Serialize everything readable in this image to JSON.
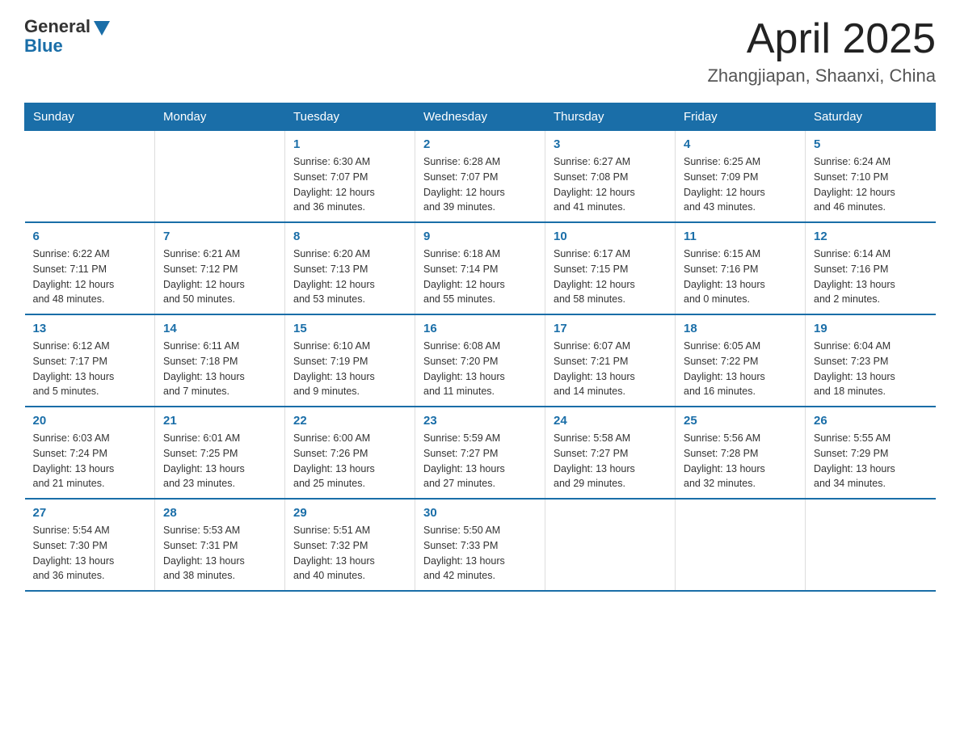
{
  "logo": {
    "general": "General",
    "blue": "Blue"
  },
  "title": {
    "month_year": "April 2025",
    "location": "Zhangjiapan, Shaanxi, China"
  },
  "weekdays": [
    "Sunday",
    "Monday",
    "Tuesday",
    "Wednesday",
    "Thursday",
    "Friday",
    "Saturday"
  ],
  "weeks": [
    [
      {
        "day": "",
        "info": ""
      },
      {
        "day": "",
        "info": ""
      },
      {
        "day": "1",
        "info": "Sunrise: 6:30 AM\nSunset: 7:07 PM\nDaylight: 12 hours\nand 36 minutes."
      },
      {
        "day": "2",
        "info": "Sunrise: 6:28 AM\nSunset: 7:07 PM\nDaylight: 12 hours\nand 39 minutes."
      },
      {
        "day": "3",
        "info": "Sunrise: 6:27 AM\nSunset: 7:08 PM\nDaylight: 12 hours\nand 41 minutes."
      },
      {
        "day": "4",
        "info": "Sunrise: 6:25 AM\nSunset: 7:09 PM\nDaylight: 12 hours\nand 43 minutes."
      },
      {
        "day": "5",
        "info": "Sunrise: 6:24 AM\nSunset: 7:10 PM\nDaylight: 12 hours\nand 46 minutes."
      }
    ],
    [
      {
        "day": "6",
        "info": "Sunrise: 6:22 AM\nSunset: 7:11 PM\nDaylight: 12 hours\nand 48 minutes."
      },
      {
        "day": "7",
        "info": "Sunrise: 6:21 AM\nSunset: 7:12 PM\nDaylight: 12 hours\nand 50 minutes."
      },
      {
        "day": "8",
        "info": "Sunrise: 6:20 AM\nSunset: 7:13 PM\nDaylight: 12 hours\nand 53 minutes."
      },
      {
        "day": "9",
        "info": "Sunrise: 6:18 AM\nSunset: 7:14 PM\nDaylight: 12 hours\nand 55 minutes."
      },
      {
        "day": "10",
        "info": "Sunrise: 6:17 AM\nSunset: 7:15 PM\nDaylight: 12 hours\nand 58 minutes."
      },
      {
        "day": "11",
        "info": "Sunrise: 6:15 AM\nSunset: 7:16 PM\nDaylight: 13 hours\nand 0 minutes."
      },
      {
        "day": "12",
        "info": "Sunrise: 6:14 AM\nSunset: 7:16 PM\nDaylight: 13 hours\nand 2 minutes."
      }
    ],
    [
      {
        "day": "13",
        "info": "Sunrise: 6:12 AM\nSunset: 7:17 PM\nDaylight: 13 hours\nand 5 minutes."
      },
      {
        "day": "14",
        "info": "Sunrise: 6:11 AM\nSunset: 7:18 PM\nDaylight: 13 hours\nand 7 minutes."
      },
      {
        "day": "15",
        "info": "Sunrise: 6:10 AM\nSunset: 7:19 PM\nDaylight: 13 hours\nand 9 minutes."
      },
      {
        "day": "16",
        "info": "Sunrise: 6:08 AM\nSunset: 7:20 PM\nDaylight: 13 hours\nand 11 minutes."
      },
      {
        "day": "17",
        "info": "Sunrise: 6:07 AM\nSunset: 7:21 PM\nDaylight: 13 hours\nand 14 minutes."
      },
      {
        "day": "18",
        "info": "Sunrise: 6:05 AM\nSunset: 7:22 PM\nDaylight: 13 hours\nand 16 minutes."
      },
      {
        "day": "19",
        "info": "Sunrise: 6:04 AM\nSunset: 7:23 PM\nDaylight: 13 hours\nand 18 minutes."
      }
    ],
    [
      {
        "day": "20",
        "info": "Sunrise: 6:03 AM\nSunset: 7:24 PM\nDaylight: 13 hours\nand 21 minutes."
      },
      {
        "day": "21",
        "info": "Sunrise: 6:01 AM\nSunset: 7:25 PM\nDaylight: 13 hours\nand 23 minutes."
      },
      {
        "day": "22",
        "info": "Sunrise: 6:00 AM\nSunset: 7:26 PM\nDaylight: 13 hours\nand 25 minutes."
      },
      {
        "day": "23",
        "info": "Sunrise: 5:59 AM\nSunset: 7:27 PM\nDaylight: 13 hours\nand 27 minutes."
      },
      {
        "day": "24",
        "info": "Sunrise: 5:58 AM\nSunset: 7:27 PM\nDaylight: 13 hours\nand 29 minutes."
      },
      {
        "day": "25",
        "info": "Sunrise: 5:56 AM\nSunset: 7:28 PM\nDaylight: 13 hours\nand 32 minutes."
      },
      {
        "day": "26",
        "info": "Sunrise: 5:55 AM\nSunset: 7:29 PM\nDaylight: 13 hours\nand 34 minutes."
      }
    ],
    [
      {
        "day": "27",
        "info": "Sunrise: 5:54 AM\nSunset: 7:30 PM\nDaylight: 13 hours\nand 36 minutes."
      },
      {
        "day": "28",
        "info": "Sunrise: 5:53 AM\nSunset: 7:31 PM\nDaylight: 13 hours\nand 38 minutes."
      },
      {
        "day": "29",
        "info": "Sunrise: 5:51 AM\nSunset: 7:32 PM\nDaylight: 13 hours\nand 40 minutes."
      },
      {
        "day": "30",
        "info": "Sunrise: 5:50 AM\nSunset: 7:33 PM\nDaylight: 13 hours\nand 42 minutes."
      },
      {
        "day": "",
        "info": ""
      },
      {
        "day": "",
        "info": ""
      },
      {
        "day": "",
        "info": ""
      }
    ]
  ]
}
